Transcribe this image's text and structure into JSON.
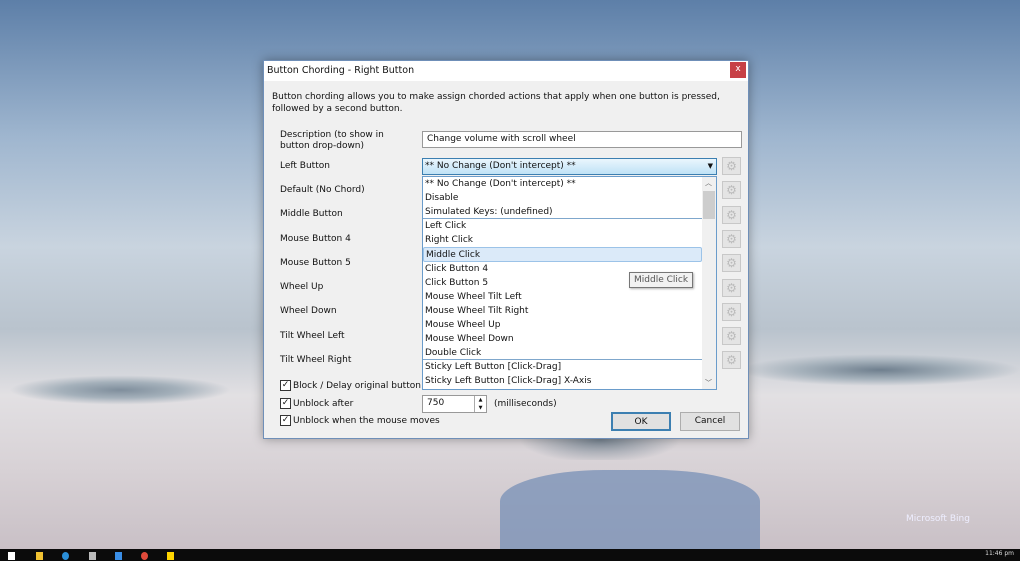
{
  "desktop": {
    "watermark": "Microsoft Bing",
    "clock": "11:46 pm",
    "taskbar_icons": [
      "windows-icon",
      "folder-icon",
      "edge-icon",
      "app-icon",
      "active-app-icon",
      "chrome-icon",
      "sticky-notes-icon"
    ]
  },
  "dialog": {
    "title": "Button Chording - Right Button",
    "close": "x",
    "intro": "Button chording allows you to make assign chorded actions that apply when one button is pressed, followed by a second button.",
    "description_label": "Description (to show in button drop-down)",
    "description_value": "Change volume with scroll wheel",
    "rows": [
      "Left Button",
      "Default (No Chord)",
      "Middle Button",
      "Mouse Button 4",
      "Mouse Button 5",
      "Wheel Up",
      "Wheel Down",
      "Tilt Wheel Left",
      "Tilt Wheel Right"
    ],
    "combo_value": "** No Change (Don't intercept) **",
    "options": [
      "** No Change (Don't intercept) **",
      "Disable",
      "Simulated Keys: (undefined)",
      "Left Click",
      "Right Click",
      "Middle Click",
      "Click Button 4",
      "Click Button 5",
      "Mouse Wheel Tilt Left",
      "Mouse Wheel Tilt Right",
      "Mouse Wheel Up",
      "Mouse Wheel Down",
      "Double Click",
      "Sticky Left Button [Click-Drag]",
      "Sticky Left Button [Click-Drag] X-Axis"
    ],
    "highlighted_option": "Middle Click",
    "tooltip": "Middle Click",
    "block_label": "Block / Delay original button action",
    "unblock_after_label": "Unblock after",
    "unblock_after_value": "750",
    "unit": "(milliseconds)",
    "unblock_move_label": "Unblock when the mouse moves",
    "ok": "OK",
    "cancel": "Cancel"
  }
}
